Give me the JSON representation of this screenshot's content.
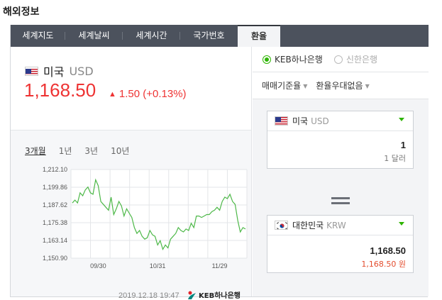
{
  "section_title": "해외정보",
  "tabs": [
    {
      "label": "세계지도",
      "active": false
    },
    {
      "label": "세계날씨",
      "active": false
    },
    {
      "label": "세계시간",
      "active": false
    },
    {
      "label": "국가번호",
      "active": false
    },
    {
      "label": "환율",
      "active": true
    }
  ],
  "currency": {
    "name": "미국",
    "code": "USD",
    "rate": "1,168.50",
    "change": "1.50 (+0.13%)",
    "change_direction": "up"
  },
  "periods": [
    {
      "label": "3개월",
      "active": true
    },
    {
      "label": "1년",
      "active": false
    },
    {
      "label": "3년",
      "active": false
    },
    {
      "label": "10년",
      "active": false
    }
  ],
  "chart_data": {
    "type": "line",
    "x_tick_labels": [
      "09/30",
      "10/31",
      "11/29"
    ],
    "y_tick_labels": [
      "1,212.10",
      "1,199.86",
      "1,187.62",
      "1,175.38",
      "1,163.14",
      "1,150.90"
    ],
    "ylim": [
      1150.9,
      1212.1
    ],
    "values": [
      1189,
      1191,
      1189,
      1196,
      1194,
      1198,
      1200,
      1196,
      1195,
      1205,
      1201,
      1190,
      1188,
      1186,
      1184,
      1193,
      1181,
      1185,
      1190,
      1187,
      1180,
      1185,
      1182,
      1179,
      1172,
      1168,
      1170,
      1166,
      1164,
      1165,
      1170,
      1167,
      1166,
      1160,
      1163,
      1157,
      1160,
      1158,
      1164,
      1166,
      1168,
      1172,
      1170,
      1169,
      1171,
      1170,
      1175,
      1172,
      1180,
      1180,
      1179,
      1180,
      1181,
      1181,
      1183,
      1184,
      1186,
      1184,
      1190,
      1193,
      1192,
      1195,
      1190,
      1188,
      1177,
      1169,
      1172,
      1171
    ],
    "series_color": "#4db848",
    "grid": true
  },
  "timestamp": "2019.12.18 19:47",
  "bank_logo_text": "KEB하나은행",
  "banks": [
    {
      "label": "KEB하나은행",
      "selected": true
    },
    {
      "label": "신한은행",
      "selected": false
    }
  ],
  "options": [
    {
      "label": "매매기준율"
    },
    {
      "label": "환율우대없음"
    }
  ],
  "from": {
    "name": "미국",
    "code": "USD",
    "amount": "1",
    "amount_text": "1 달러"
  },
  "to": {
    "name": "대한민국",
    "code": "KRW",
    "amount": "1,168.50",
    "amount_text": "1,168.50 원"
  },
  "colors": {
    "accent_green": "#2db400",
    "up_red": "#e33333",
    "tab_bg": "#4c525d"
  }
}
